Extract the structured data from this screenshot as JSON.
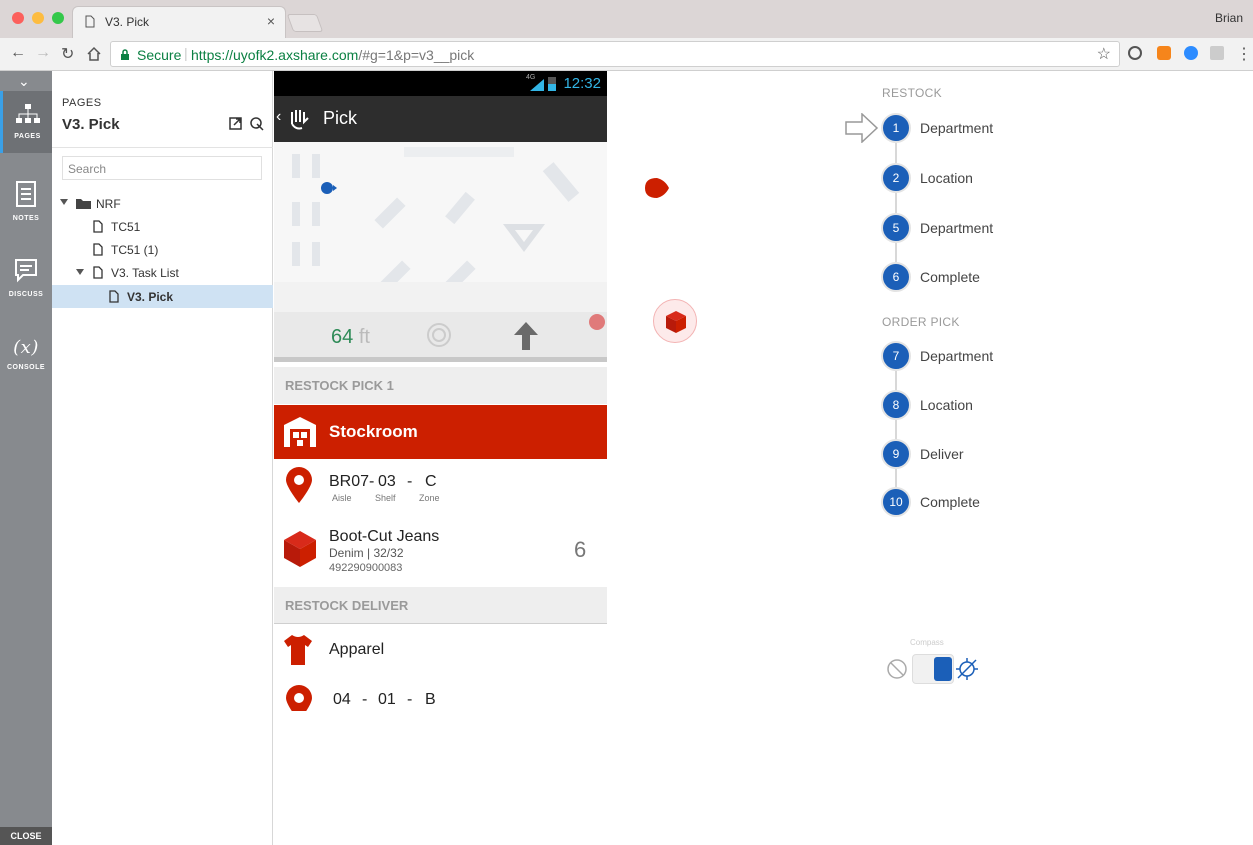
{
  "browser": {
    "tab_title": "V3. Pick",
    "user": "Brian",
    "secure_label": "Secure",
    "url_host": "https://uyofk2.axshare.com",
    "url_path": "/#g=1&p=v3__pick"
  },
  "rail": {
    "pages": "PAGES",
    "notes": "NOTES",
    "discuss": "DISCUSS",
    "console": "CONSOLE",
    "console_glyph": "(x)",
    "close": "CLOSE"
  },
  "pages_panel": {
    "label": "PAGES",
    "title": "V3. Pick",
    "search_placeholder": "Search",
    "tree": [
      "NRF",
      "TC51",
      "TC51 (1)",
      "V3. Task List",
      "V3. Pick"
    ]
  },
  "phone": {
    "signal": "4G",
    "time": "12:32",
    "title": "Pick",
    "distance": "64",
    "distance_unit": "ft",
    "section_restock_pick": "RESTOCK PICK 1",
    "stockroom": "Stockroom",
    "location": {
      "aisle": "BR07",
      "shelf": "03",
      "zone": "C",
      "aisle_label": "Aisle",
      "shelf_label": "Shelf",
      "zone_label": "Zone",
      "sep": "-"
    },
    "item": {
      "name": "Boot-Cut Jeans",
      "detail": "Denim | 32/32",
      "sku": "492290900083",
      "qty": "6"
    },
    "section_restock_deliver": "RESTOCK DELIVER",
    "apparel": "Apparel",
    "location2": {
      "aisle": "04",
      "shelf": "01",
      "zone": "B",
      "sep": "-"
    }
  },
  "steps": {
    "restock_label": "RESTOCK",
    "restock": [
      {
        "num": "1",
        "label": "Department"
      },
      {
        "num": "2",
        "label": "Location"
      },
      {
        "num": "5",
        "label": "Department"
      },
      {
        "num": "6",
        "label": "Complete"
      }
    ],
    "order_label": "ORDER PICK",
    "order": [
      {
        "num": "7",
        "label": "Department"
      },
      {
        "num": "8",
        "label": "Location"
      },
      {
        "num": "9",
        "label": "Deliver"
      },
      {
        "num": "10",
        "label": "Complete"
      }
    ]
  },
  "compass": {
    "label": "Compass"
  },
  "colors": {
    "accent_red": "#cc1f00",
    "step_blue": "#1b5fb8",
    "secure_green": "#0b8043"
  }
}
